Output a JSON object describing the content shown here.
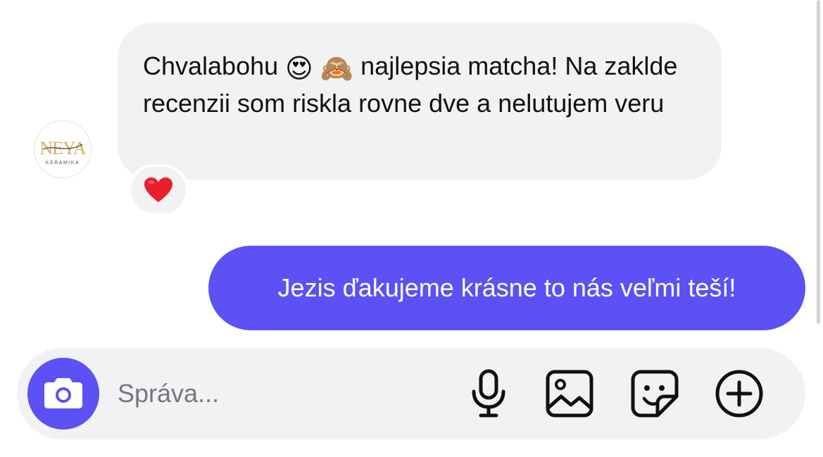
{
  "thread": {
    "incoming": {
      "avatar": {
        "logo_text": "NEYA",
        "logo_subtext": "KERAMIKA"
      },
      "text_before_emoji": "Chvalabohu",
      "emoji_1": "😍",
      "emoji_2": "🙈",
      "text_after_emoji": "najlepsia matcha! Na zaklde recenzii som riskla rovne dve a nelutujem veru",
      "reaction": "heart-icon"
    },
    "outgoing": {
      "text": "Jezis ďakujeme krásne to nás veľmi teší!"
    }
  },
  "composer": {
    "placeholder": "Správa...",
    "value": "",
    "icons": [
      "camera-icon",
      "microphone-icon",
      "image-icon",
      "sticker-icon",
      "add-icon"
    ]
  },
  "colors": {
    "accent": "#5b51f5",
    "bubble_incoming": "#f2f2f4",
    "reaction_heart": "#e8202e",
    "logo_gold": "#d6b15a"
  }
}
